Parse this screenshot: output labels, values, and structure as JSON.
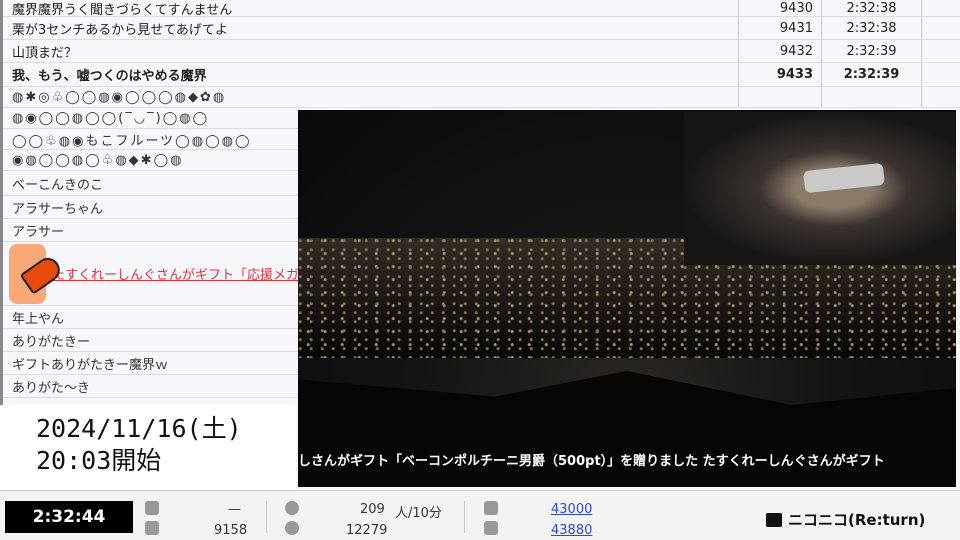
{
  "comments": [
    {
      "text": "魔界魔界うく聞きづらくてすんません",
      "no": "9430",
      "time": "2:32:38"
    },
    {
      "text": "栗が3センチあるから見せてあげてよ",
      "no": "9431",
      "time": "2:32:38"
    },
    {
      "text": "山頂まだ？",
      "no": "9432",
      "time": "2:32:39"
    },
    {
      "text": "我、もう、嘘つくのはやめる魔界",
      "no": "9433",
      "time": "2:32:39",
      "bold": true
    }
  ],
  "emoji_rows": [
    "◍✱◎♧◯◯◍◉◯◯◯◍◆✿◍",
    "◍◉◯◯◍◯◯(‾◡‾)◯◍◯",
    "◯◯♧◍◉もこフルーツ◯◍◯◍◯",
    "◉◍◯◯◍◯♧◍◆✱◯◍"
  ],
  "lower_comments": [
    "べーこんきのこ",
    "アラサーちゃん",
    "アラサー"
  ],
  "gift_comment": "たすくれーしんぐさんがギフト「応援メガ",
  "after_comments": [
    "年上やん",
    "ありがたきー",
    "ギフトありがたきー魔界ｗ",
    "ありがた～き"
  ],
  "ticker": "しさんがギフト「ベーコンポルチーニ男爵（500pt）」を贈りました たすくれーしんぐさんがギフト",
  "date_line1": "2024/11/16(土)",
  "date_line2": "20:03開始",
  "status": {
    "elapsed": "2:32:44",
    "comments_rate": "—",
    "comments_total": "9158",
    "viewers_rate": "209",
    "viewers_unit": "人/10分",
    "viewers_total": "12279",
    "ad_points": "43000",
    "gift_points": "43880",
    "logo": "ニコニコ(Re:turn)"
  }
}
